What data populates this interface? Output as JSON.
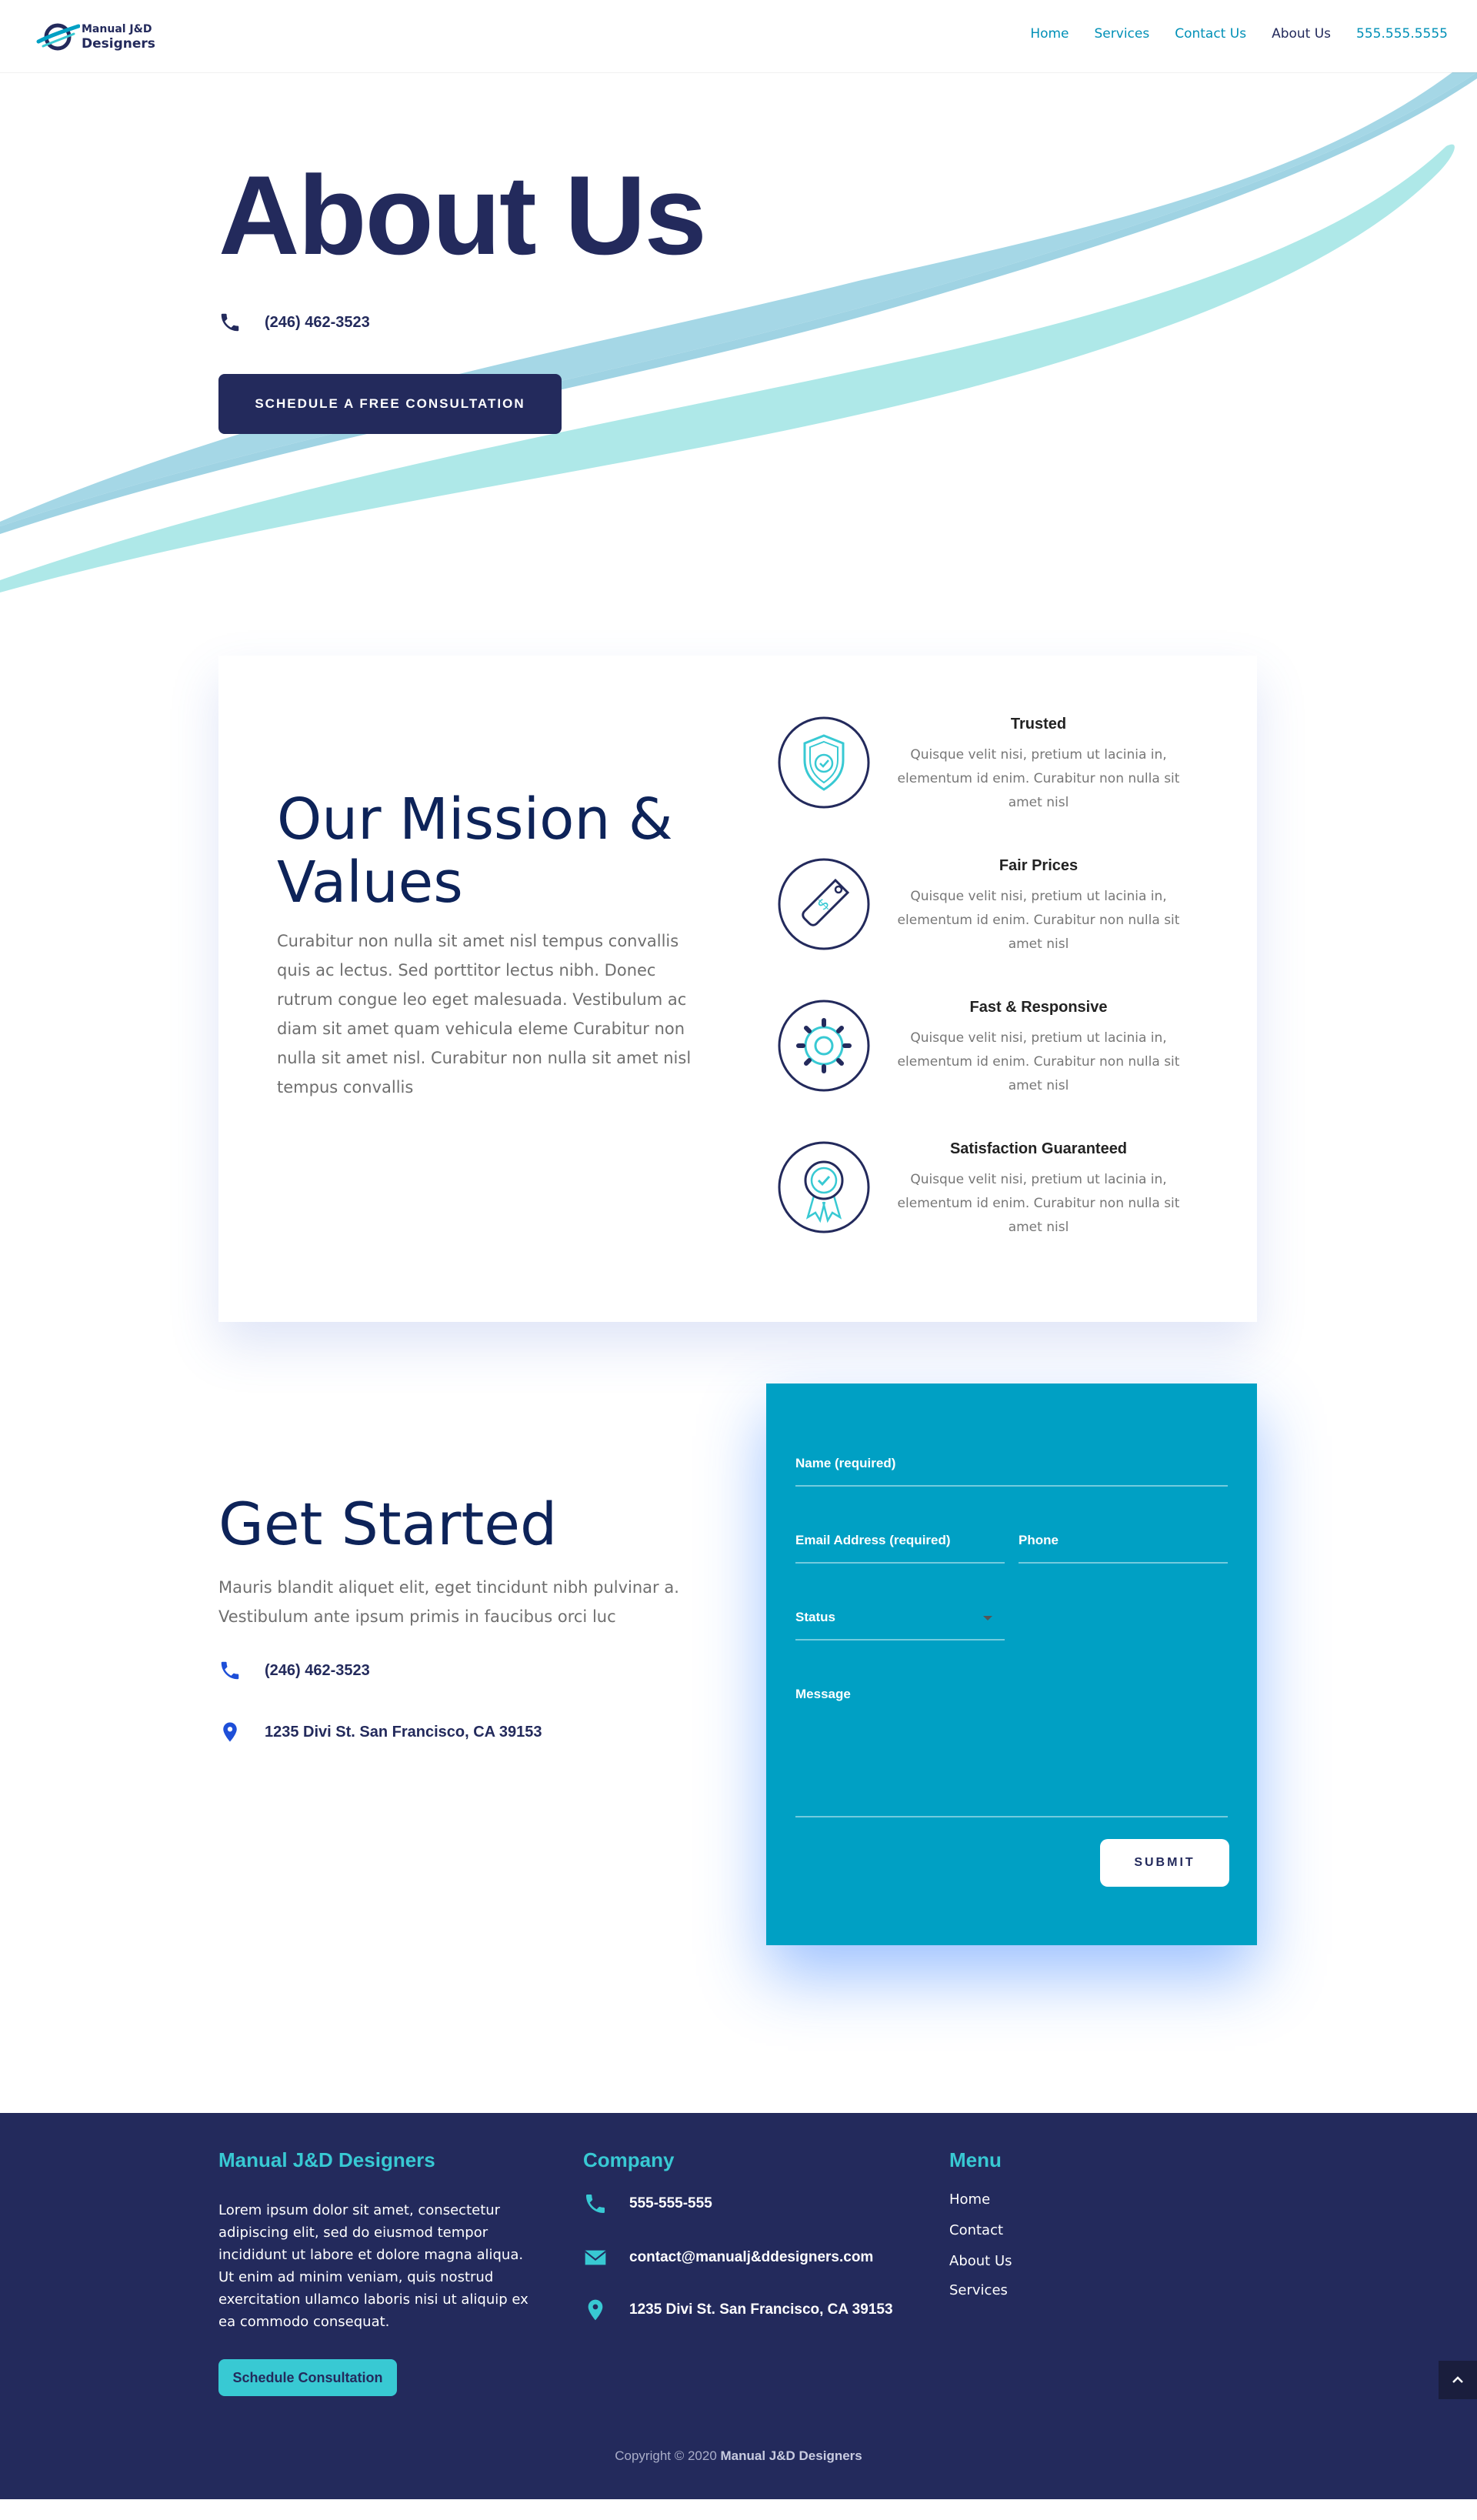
{
  "header": {
    "logo": {
      "line1": "Manual J&D",
      "line2": "Designers"
    },
    "nav": [
      {
        "label": "Home"
      },
      {
        "label": "Services"
      },
      {
        "label": "Contact Us"
      },
      {
        "label": "About Us",
        "active": true
      },
      {
        "label": "555.555.5555"
      }
    ]
  },
  "hero": {
    "title": "About Us",
    "phone": "(246) 462-3523",
    "cta": "SCHEDULE A FREE CONSULTATION"
  },
  "mission": {
    "title": "Our Mission & Values",
    "text": "Curabitur non nulla sit amet nisl tempus convallis quis ac lectus. Sed porttitor lectus nibh. Donec rutrum congue leo eget malesuada. Vestibulum ac diam sit amet quam vehicula eleme Curabitur non nulla sit amet nisl. Curabitur non nulla sit amet nisl tempus convallis",
    "features": [
      {
        "title": "Trusted",
        "desc": "Quisque velit nisi, pretium ut lacinia in, elementum id enim. Curabitur non nulla sit amet nisl",
        "icon": "shield-check-icon"
      },
      {
        "title": "Fair Prices",
        "desc": "Quisque velit nisi, pretium ut lacinia in, elementum id enim. Curabitur non nulla sit amet nisl",
        "icon": "price-tag-icon"
      },
      {
        "title": "Fast & Responsive",
        "desc": "Quisque velit nisi, pretium ut lacinia in, elementum id enim. Curabitur non nulla sit amet nisl",
        "icon": "gear-icon"
      },
      {
        "title": "Satisfaction Guaranteed",
        "desc": "Quisque velit nisi, pretium ut lacinia in, elementum id enim. Curabitur non nulla sit amet nisl",
        "icon": "award-badge-icon"
      }
    ]
  },
  "get_started": {
    "title": "Get Started",
    "text": "Mauris blandit aliquet elit, eget tincidunt nibh pulvinar a. Vestibulum ante ipsum primis in faucibus orci luc",
    "phone": "(246) 462-3523",
    "address": "1235 Divi St. San Francisco, CA 39153"
  },
  "form": {
    "name_label": "Name (required)",
    "email_label": "Email Address (required)",
    "phone_label": "Phone",
    "status_label": "Status",
    "message_label": "Message",
    "submit": "SUBMIT"
  },
  "footer": {
    "col1_title": "Manual J&D Designers",
    "about": "Lorem ipsum dolor sit amet, consectetur adipiscing elit, sed do eiusmod tempor incididunt ut labore et dolore magna aliqua. Ut enim ad minim veniam, quis nostrud exercitation ullamco laboris nisi ut aliquip ex ea commodo consequat.",
    "cta": "Schedule Consultation",
    "col2_title": "Company",
    "phone": "555-555-555",
    "email": "contact@manualj&ddesigners.com",
    "address": "1235 Divi St. San Francisco, CA 39153",
    "col3_title": "Menu",
    "menu": [
      "Home",
      "Contact",
      "About Us",
      "Services"
    ],
    "copyright_prefix": "Copyright © 2020",
    "copyright_brand": "Manual J&D Designers"
  },
  "colors": {
    "navy": "#232a5c",
    "dark_blue": "#0d2359",
    "teal": "#00a0c4",
    "accent": "#38c9d3",
    "wave_blue": "#a5d7e6",
    "wave_cyan": "#aee8e8"
  }
}
